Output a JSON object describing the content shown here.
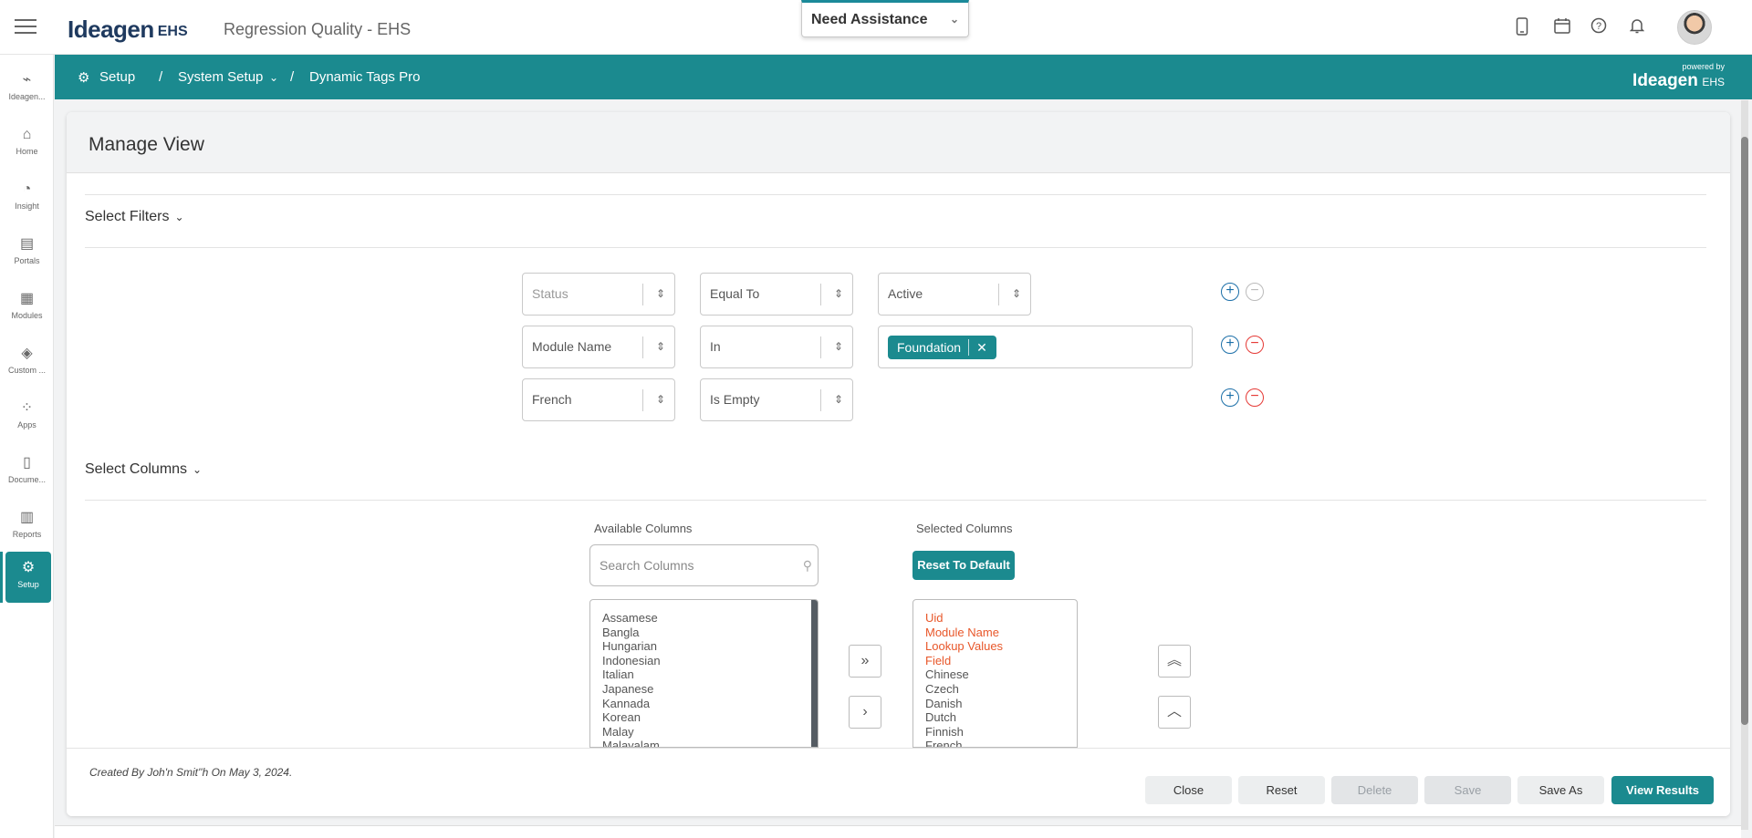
{
  "header": {
    "logo_text": "Ideagen",
    "logo_sub": "EHS",
    "app_title": "Regression Quality - EHS",
    "assistance_label": "Need Assistance"
  },
  "icons": {
    "mobile": "mobile-icon",
    "calendar": "calendar-icon",
    "help": "help-icon",
    "notifications": "bell-icon"
  },
  "sidebar": {
    "items": [
      {
        "label": "Ideagen...",
        "icon": "ideagen-logo-icon"
      },
      {
        "label": "Home",
        "icon": "home-icon"
      },
      {
        "label": "Insight",
        "icon": "pie-chart-icon"
      },
      {
        "label": "Portals",
        "icon": "portal-icon"
      },
      {
        "label": "Modules",
        "icon": "grid-icon"
      },
      {
        "label": "Custom ...",
        "icon": "layers-icon"
      },
      {
        "label": "Apps",
        "icon": "apps-icon"
      },
      {
        "label": "Docume...",
        "icon": "document-icon"
      },
      {
        "label": "Reports",
        "icon": "bar-chart-icon"
      },
      {
        "label": "Setup",
        "icon": "gear-icon"
      }
    ]
  },
  "breadcrumb": {
    "items": [
      "Setup",
      "System Setup",
      "Dynamic Tags Pro"
    ],
    "separator": "/",
    "powered_by": "powered by",
    "powered_logo": "Ideagen",
    "powered_sub": "EHS"
  },
  "panel": {
    "title": "Manage View",
    "filters_title": "Select Filters",
    "columns_title": "Select Columns"
  },
  "filters": [
    {
      "field": "Status",
      "operator": "Equal To",
      "value": "Active"
    },
    {
      "field": "Module Name",
      "operator": "In",
      "tag": "Foundation"
    },
    {
      "field": "French",
      "operator": "Is Empty"
    }
  ],
  "columns": {
    "available_label": "Available Columns",
    "selected_label": "Selected Columns",
    "search_placeholder": "Search Columns",
    "reset_label": "Reset To Default",
    "available": [
      "Assamese",
      "Bangla",
      "Hungarian",
      "Indonesian",
      "Italian",
      "Japanese",
      "Kannada",
      "Korean",
      "Malay",
      "Malayalam"
    ],
    "selected": [
      {
        "label": "Uid",
        "required": true
      },
      {
        "label": "Module Name",
        "required": true
      },
      {
        "label": "Lookup Values",
        "required": true
      },
      {
        "label": "Field",
        "required": true
      },
      {
        "label": "Chinese",
        "required": false
      },
      {
        "label": "Czech",
        "required": false
      },
      {
        "label": "Danish",
        "required": false
      },
      {
        "label": "Dutch",
        "required": false
      },
      {
        "label": "Finnish",
        "required": false
      },
      {
        "label": "French",
        "required": false
      }
    ]
  },
  "footer": {
    "created": "Created By Joh'n Smit''h On May 3, 2024.",
    "buttons": {
      "close": "Close",
      "reset": "Reset",
      "delete": "Delete",
      "save": "Save",
      "save_as": "Save As",
      "view_results": "View Results"
    }
  },
  "colors": {
    "accent": "#1b8a8f",
    "required_column": "#e8572a",
    "remove": "#e53935",
    "add": "#1b6fa8"
  }
}
